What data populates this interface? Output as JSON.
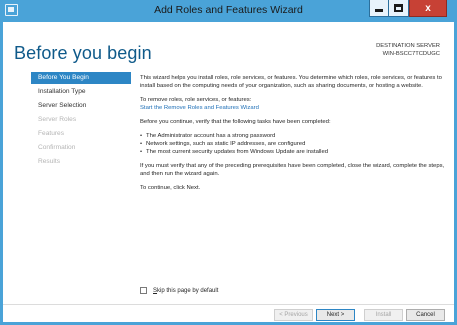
{
  "window": {
    "title": "Add Roles and Features Wizard",
    "controls": {
      "minimize_icon": "minimize-icon",
      "maximize_icon": "maximize-icon",
      "close_glyph": "x"
    }
  },
  "header": {
    "heading": "Before you begin",
    "destination_label": "DESTINATION SERVER",
    "destination_server": "WIN-BSCC7TCDUGC"
  },
  "nav": {
    "items": [
      {
        "label": "Before You Begin",
        "state": "active"
      },
      {
        "label": "Installation Type",
        "state": "enabled"
      },
      {
        "label": "Server Selection",
        "state": "enabled"
      },
      {
        "label": "Server Roles",
        "state": "disabled"
      },
      {
        "label": "Features",
        "state": "disabled"
      },
      {
        "label": "Confirmation",
        "state": "disabled"
      },
      {
        "label": "Results",
        "state": "disabled"
      }
    ]
  },
  "content": {
    "intro": "This wizard helps you install roles, role services, or features. You determine which roles, role services, or features to install based on the computing needs of your organization, such as sharing documents, or hosting a website.",
    "remove_text": "To remove roles, role services, or features:",
    "remove_link": "Start the Remove Roles and Features Wizard",
    "verify_text": "Before you continue, verify that the following tasks have been completed:",
    "bullets": [
      "The Administrator account has a strong password",
      "Network settings, such as static IP addresses, are configured",
      "The most current security updates from Windows Update are installed"
    ],
    "prereq_text": "If you must verify that any of the preceding prerequisites have been completed, close the wizard, complete the steps, and then run the wizard again.",
    "continue_text": "To continue, click Next."
  },
  "skip": {
    "label_underlined": "S",
    "label_rest": "kip this page by default",
    "checked": false
  },
  "footer": {
    "previous": "< Previous",
    "next": "Next >",
    "install": "Install",
    "cancel": "Cancel"
  },
  "colors": {
    "title_bar": "#4aa3d8",
    "accent": "#2d86c5",
    "heading": "#0f5a8a",
    "close_button": "#c74135",
    "link": "#1e6fb7"
  }
}
